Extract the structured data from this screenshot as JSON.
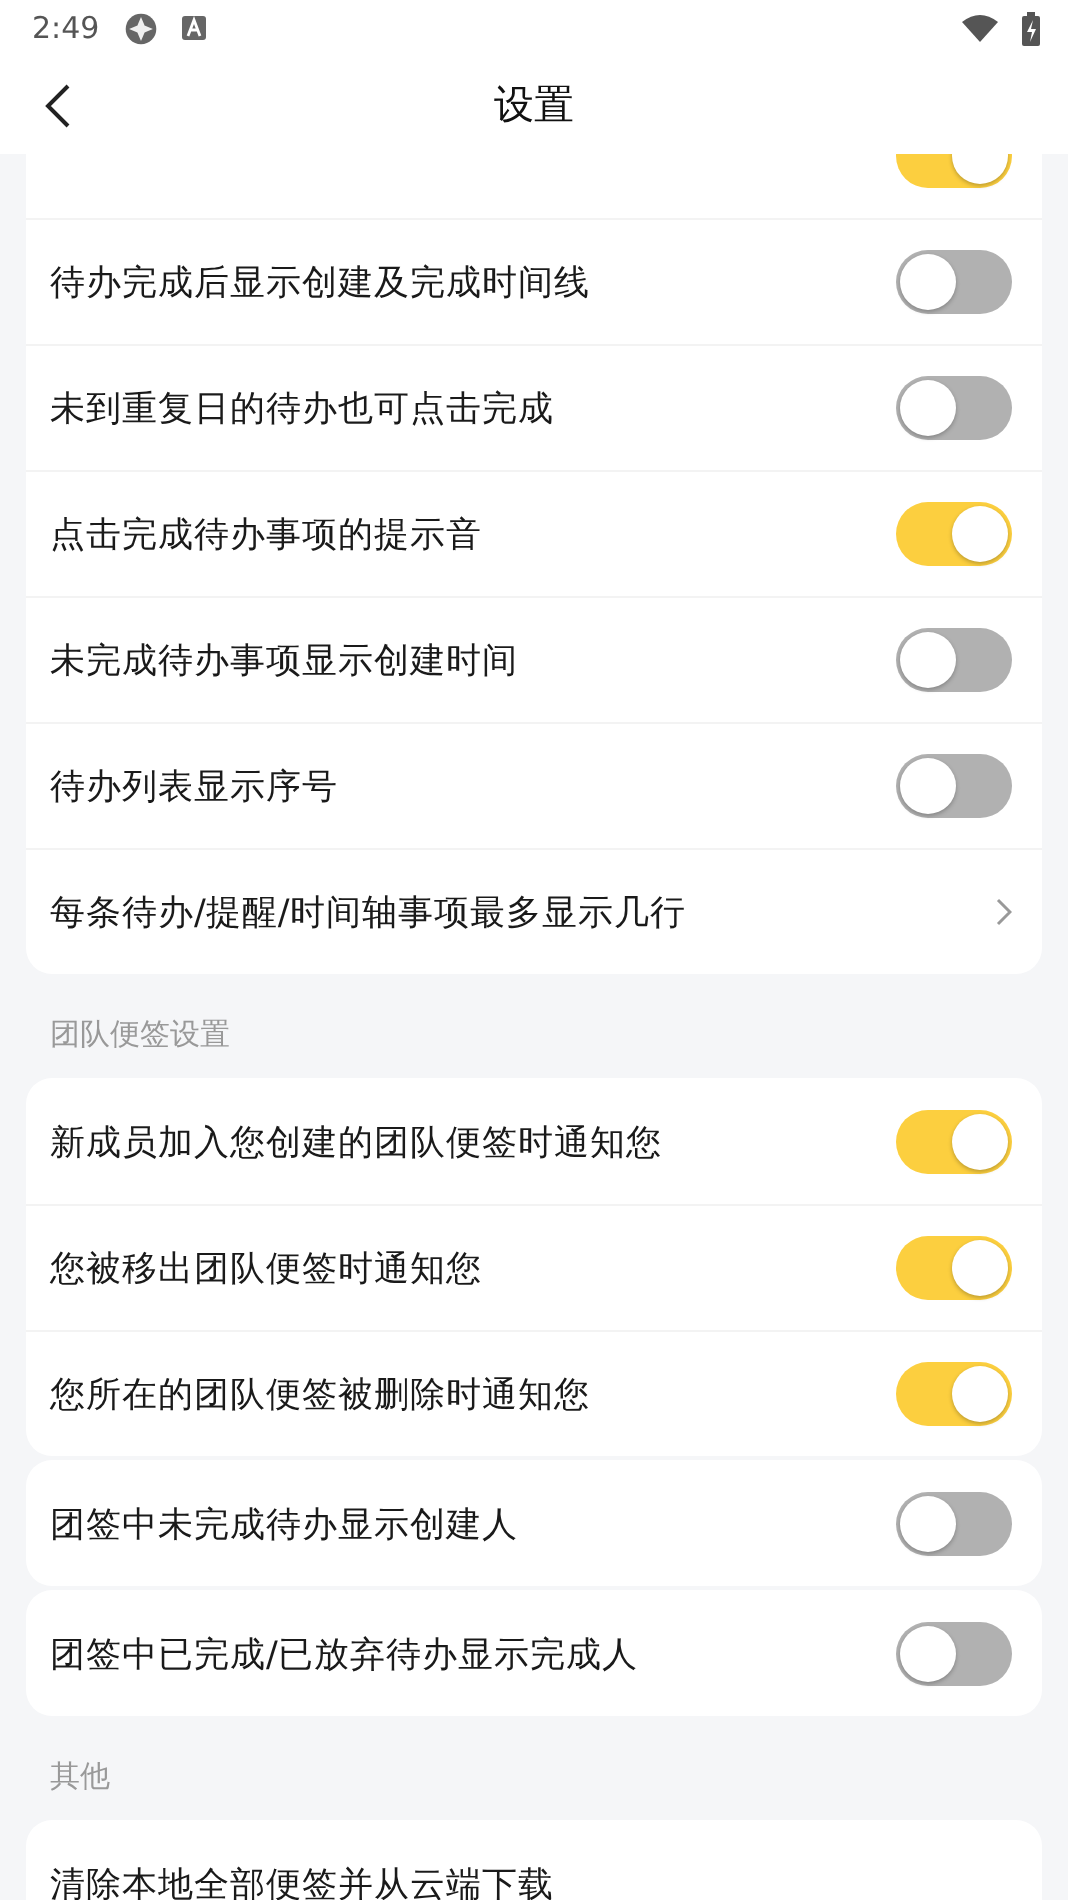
{
  "status_bar": {
    "time": "2:49"
  },
  "header": {
    "title": "设置"
  },
  "sections": [
    {
      "cards": [
        {
          "rows": [
            {
              "kind": "toggle",
              "on": true
            },
            {
              "kind": "toggle",
              "label": "待办完成后显示创建及完成时间线",
              "on": false
            },
            {
              "kind": "toggle",
              "label": "未到重复日的待办也可点击完成",
              "on": false
            },
            {
              "kind": "toggle",
              "label": "点击完成待办事项的提示音",
              "on": true
            },
            {
              "kind": "toggle",
              "label": "未完成待办事项显示创建时间",
              "on": false
            },
            {
              "kind": "toggle",
              "label": "待办列表显示序号",
              "on": false
            },
            {
              "kind": "link",
              "label": "每条待办/提醒/时间轴事项最多显示几行"
            }
          ]
        }
      ]
    },
    {
      "title": "团队便签设置",
      "cards": [
        {
          "rows": [
            {
              "kind": "toggle",
              "label": "新成员加入您创建的团队便签时通知您",
              "on": true
            },
            {
              "kind": "toggle",
              "label": "您被移出团队便签时通知您",
              "on": true
            },
            {
              "kind": "toggle",
              "label": "您所在的团队便签被删除时通知您",
              "on": true
            }
          ]
        },
        {
          "rows": [
            {
              "kind": "toggle",
              "label": "团签中未完成待办显示创建人",
              "on": false
            }
          ]
        },
        {
          "rows": [
            {
              "kind": "toggle",
              "label": "团签中已完成/已放弃待办显示完成人",
              "on": false
            }
          ]
        }
      ]
    },
    {
      "title": "其他",
      "cards": [
        {
          "rows": [
            {
              "kind": "action",
              "label": "清除本地全部便签并从云端下载"
            }
          ]
        }
      ]
    }
  ]
}
